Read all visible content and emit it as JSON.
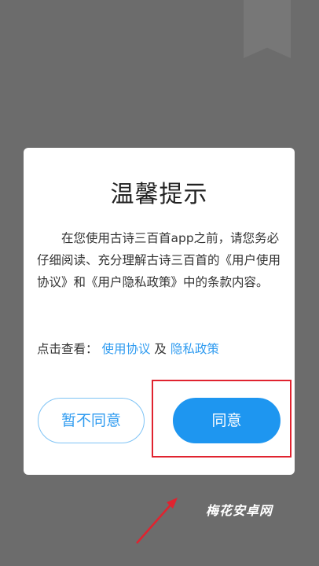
{
  "dialog": {
    "title": "温馨提示",
    "body": "在您使用古诗三百首app之前，请您务必仔细阅读、充分理解古诗三百首的《用户使用协议》和《用户隐私政策》中的条款内容。",
    "links_prefix": "点击查看：",
    "user_agreement_link": "使用协议",
    "links_joiner": "及",
    "privacy_policy_link": "隐私政策",
    "disagree_label": "暂不同意",
    "agree_label": "同意"
  },
  "watermark": "梅花安卓网",
  "colors": {
    "overlay": "#6c6c6c",
    "accent": "#1e96f0",
    "link": "#2f9bf0",
    "highlight": "#e0232f"
  },
  "icons": {
    "annotation_arrow": "arrow-up-right-icon",
    "ribbon": "bookmark-ribbon-icon"
  }
}
